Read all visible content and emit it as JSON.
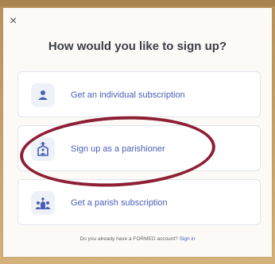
{
  "dialog": {
    "close_label": "×",
    "title": "How would you like to sign up?",
    "options": [
      {
        "label": "Get an individual subscription",
        "icon": "person-icon"
      },
      {
        "label": "Sign up as a parishioner",
        "icon": "church-person-icon"
      },
      {
        "label": "Get a parish subscription",
        "icon": "parish-group-icon"
      }
    ],
    "footer_text": "Do you already have a FORMED account?",
    "footer_link": "Sign in"
  },
  "colors": {
    "accent": "#4a5fb5",
    "annotation": "#8e1f35",
    "frame": "#c9a46a"
  }
}
